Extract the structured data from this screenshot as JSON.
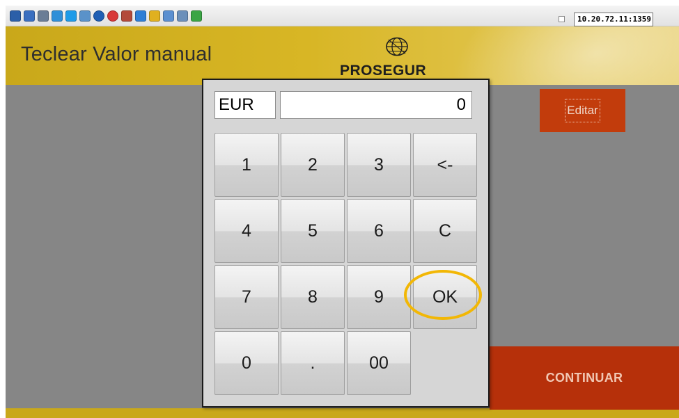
{
  "toolbar": {
    "icons": [
      {
        "name": "settings-cog-icon",
        "color": "#2b5fa8"
      },
      {
        "name": "screen-icon",
        "color": "#3a6fc0"
      },
      {
        "name": "gear-icon",
        "color": "#6a7d96"
      },
      {
        "name": "refresh-icon",
        "color": "#2f8fd8"
      },
      {
        "name": "windows-icon",
        "color": "#1e9be8"
      },
      {
        "name": "terminal-icon",
        "color": "#5a92c9"
      },
      {
        "name": "info-icon",
        "color": "#1f5fb5"
      },
      {
        "name": "stop-icon",
        "color": "#d83838"
      },
      {
        "name": "thermometer-icon",
        "color": "#b34a3a"
      },
      {
        "name": "monitor-icon",
        "color": "#2e7fd6"
      },
      {
        "name": "folder-icon",
        "color": "#e0b020"
      },
      {
        "name": "window-icon",
        "color": "#5b8fd0"
      },
      {
        "name": "display-icon",
        "color": "#6b8fba"
      },
      {
        "name": "chat-icon",
        "color": "#3aa545"
      }
    ],
    "ip_address": "10.20.72.11:1359"
  },
  "header": {
    "title": "Teclear Valor manual",
    "logo_text": "PROSEGUR"
  },
  "actions": {
    "edit_label": "Editar",
    "continue_label": "CONTINUAR"
  },
  "keypad": {
    "currency": "EUR",
    "amount": "0",
    "keys": [
      "1",
      "2",
      "3",
      "<-",
      "4",
      "5",
      "6",
      "C",
      "7",
      "8",
      "9",
      "OK",
      "0",
      ".",
      "00"
    ]
  },
  "colors": {
    "header_gold": "#d8b625",
    "action_red": "#c23c0c",
    "highlight": "#f2b705"
  }
}
